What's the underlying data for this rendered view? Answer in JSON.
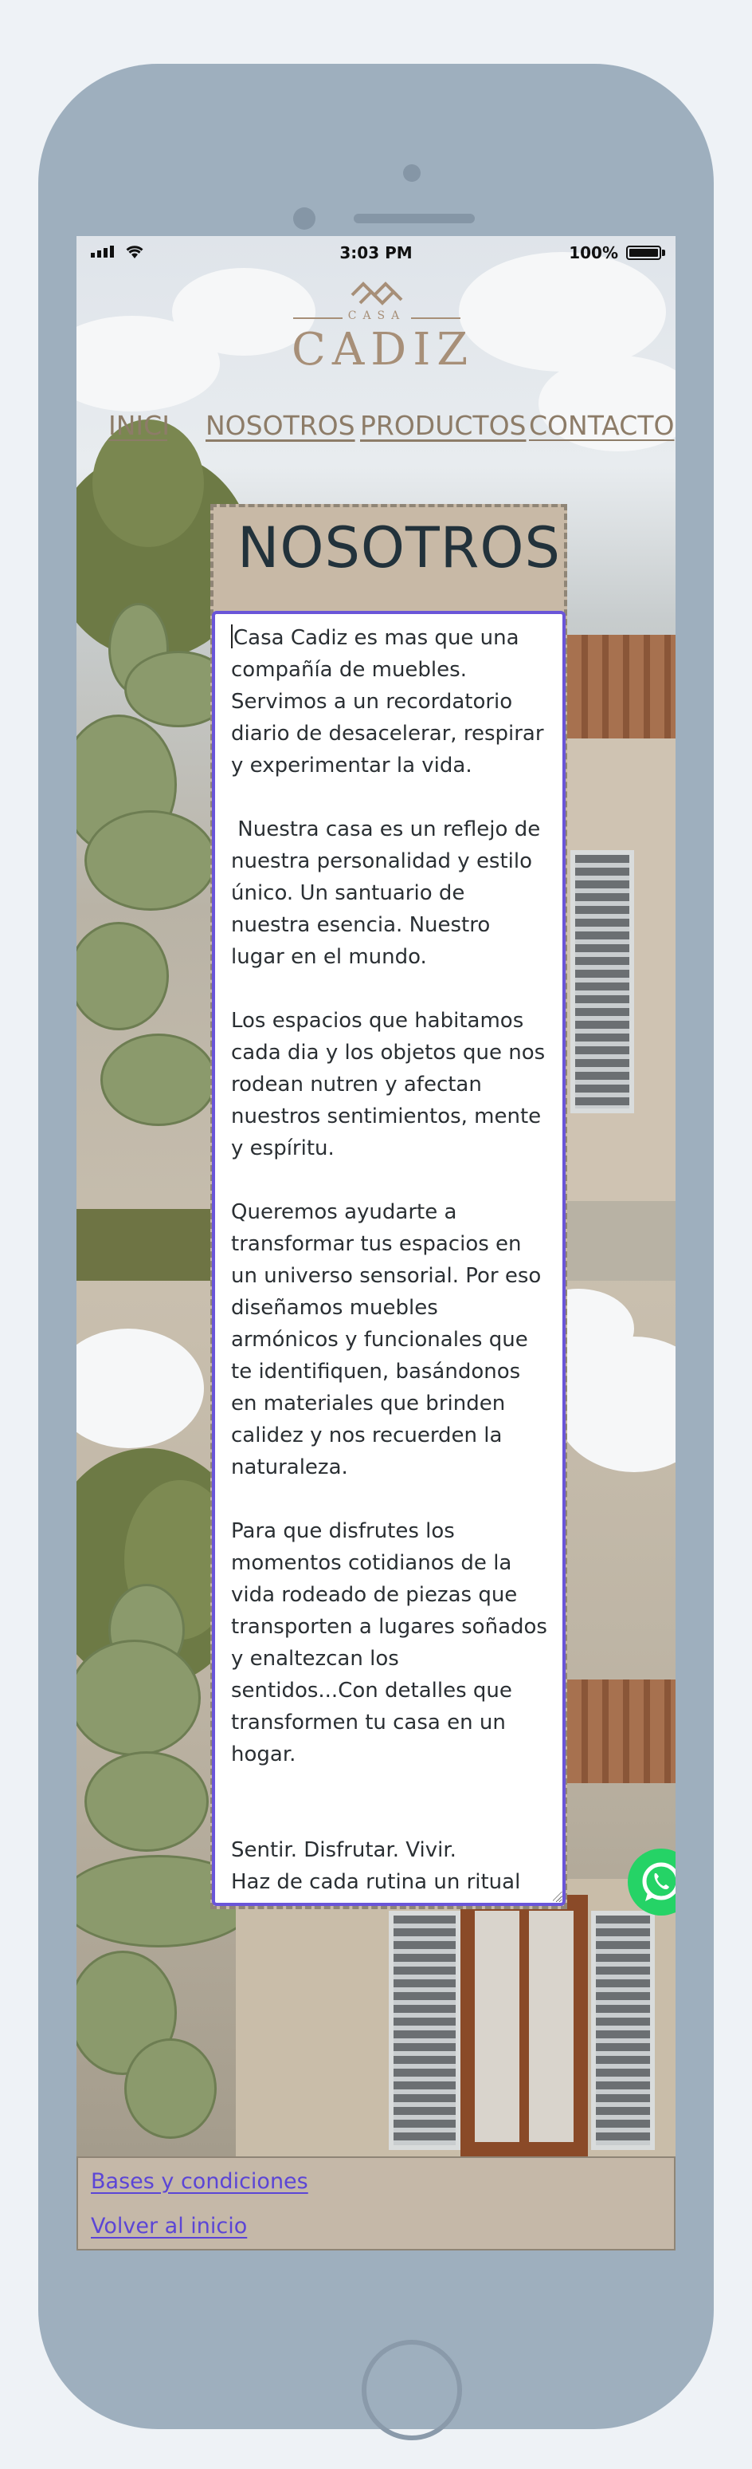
{
  "status_bar": {
    "time": "3:03 PM",
    "battery": "100%"
  },
  "brand": {
    "casa": "CASA",
    "cadiz": "CADIZ"
  },
  "nav": {
    "items": [
      {
        "label": "INICIO"
      },
      {
        "label": "NOSOTROS"
      },
      {
        "label": "PRODUCTOS"
      },
      {
        "label": "CONTACTO"
      }
    ]
  },
  "about": {
    "title": "NOSOTROS",
    "text": "Casa Cadiz es mas que una compañía de muebles. Servimos a un recordatorio diario de desacelerar, respirar y experimentar la vida.\n\n Nuestra casa es un reflejo de nuestra personalidad y estilo único. Un santuario de nuestra esencia. Nuestro lugar en el mundo.\n\nLos espacios que habitamos cada dia y los objetos que nos rodean nutren y afectan nuestros sentimientos, mente y espíritu.\n\nQueremos ayudarte a transformar tus espacios en un universo sensorial. Por eso diseñamos muebles armónicos y funcionales que te identifiquen, basándonos en materiales que brinden calidez y nos recuerden la naturaleza.\n\nPara que disfrutes los momentos cotidianos de la vida rodeado de piezas que transporten a lugares soñados y enaltezcan los sentidos...Con detalles que transformen tu casa en un hogar.\n\n\nSentir. Disfrutar. Vivir.\nHaz de cada rutina un ritual"
  },
  "footer": {
    "terms": "Bases y condiciones",
    "back": "Volver al inicio"
  },
  "icons": {
    "whatsapp": "whatsapp-icon",
    "signal": "signal-icon",
    "wifi": "wifi-icon",
    "battery": "battery-icon"
  },
  "colors": {
    "brand": "#a78f78",
    "nav": "#8d7c68",
    "title": "#22323b",
    "link": "#5b45d6",
    "focus_border": "#6a55d8",
    "whatsapp": "#25d366"
  }
}
